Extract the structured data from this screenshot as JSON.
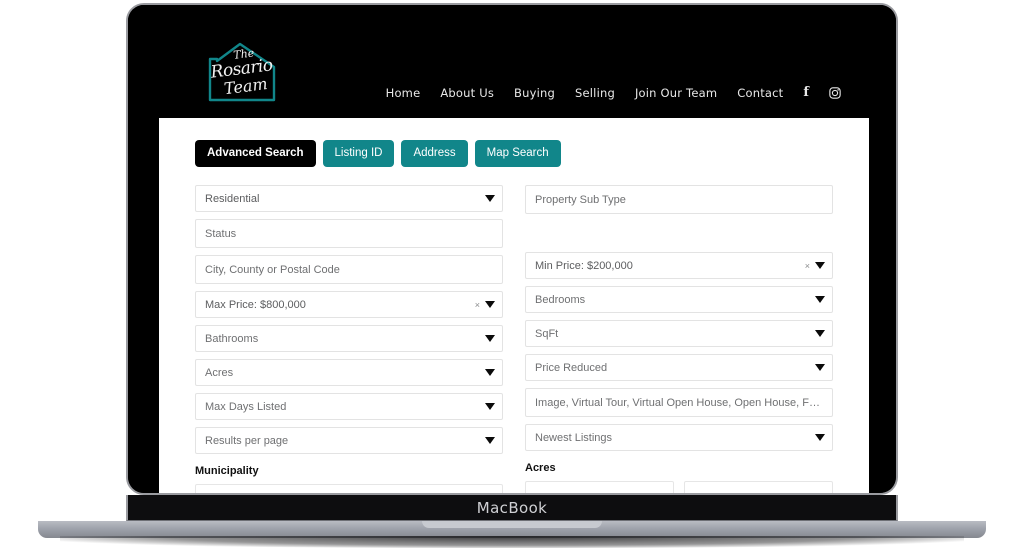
{
  "device": {
    "wordmark": "MacBook"
  },
  "site": {
    "logo": {
      "line1": "The",
      "line2": "Rosario",
      "line3": "Team",
      "accent_color": "#11868a"
    },
    "nav": [
      {
        "label": "Home"
      },
      {
        "label": "About Us"
      },
      {
        "label": "Buying"
      },
      {
        "label": "Selling"
      },
      {
        "label": "Join Our Team"
      },
      {
        "label": "Contact"
      }
    ],
    "social": [
      {
        "name": "facebook-icon",
        "glyph": "f"
      },
      {
        "name": "instagram-icon",
        "glyph": ""
      }
    ]
  },
  "search": {
    "tabs": [
      {
        "label": "Advanced Search",
        "active": true
      },
      {
        "label": "Listing ID",
        "active": false
      },
      {
        "label": "Address",
        "active": false
      },
      {
        "label": "Map Search",
        "active": false
      }
    ],
    "active_tab_color": "#000000",
    "tab_color": "#11868a",
    "left_fields": [
      {
        "name": "property-type-select",
        "label": "Residential",
        "type": "select",
        "filled": true,
        "clearable": false
      },
      {
        "name": "status-select",
        "label": "Status",
        "type": "multiselect",
        "filled": false,
        "clearable": false
      },
      {
        "name": "location-input",
        "label": "City, County or Postal Code",
        "type": "multiselect",
        "filled": false,
        "clearable": false
      },
      {
        "name": "max-price-select",
        "label": "Max Price: $800,000",
        "type": "select",
        "filled": true,
        "clearable": true
      },
      {
        "name": "bathrooms-select",
        "label": "Bathrooms",
        "type": "select",
        "filled": false,
        "clearable": false
      },
      {
        "name": "acres-select",
        "label": "Acres",
        "type": "select",
        "filled": false,
        "clearable": false
      },
      {
        "name": "max-days-listed-select",
        "label": "Max Days Listed",
        "type": "select",
        "filled": false,
        "clearable": false
      },
      {
        "name": "results-per-page-select",
        "label": "Results per page",
        "type": "select",
        "filled": false,
        "clearable": false
      }
    ],
    "right_fields": [
      {
        "name": "property-sub-type-select",
        "label": "Property Sub Type",
        "type": "multiselect",
        "filled": false,
        "clearable": false
      },
      {
        "name": "min-price-select",
        "label": "Min Price: $200,000",
        "type": "select",
        "filled": true,
        "clearable": true
      },
      {
        "name": "bedrooms-select",
        "label": "Bedrooms",
        "type": "select",
        "filled": false,
        "clearable": false
      },
      {
        "name": "sqft-select",
        "label": "SqFt",
        "type": "select",
        "filled": false,
        "clearable": false
      },
      {
        "name": "price-reduced-select",
        "label": "Price Reduced",
        "type": "select",
        "filled": false,
        "clearable": false
      },
      {
        "name": "media-features-select",
        "label": "Image, Virtual Tour, Virtual Open House, Open House, Featured",
        "type": "multiselect",
        "filled": false,
        "clearable": false
      },
      {
        "name": "sort-order-select",
        "label": "Newest Listings",
        "type": "select",
        "filled": false,
        "clearable": false
      }
    ],
    "municipality_heading": "Municipality",
    "acres_heading": "Acres"
  }
}
